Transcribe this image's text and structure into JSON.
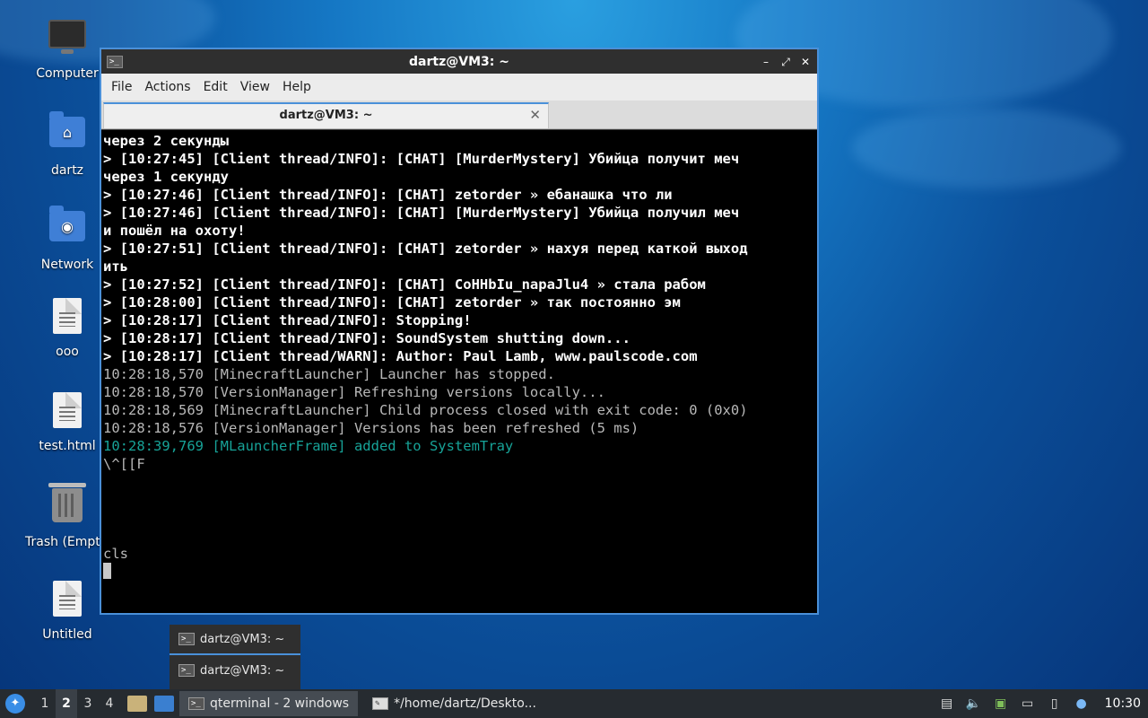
{
  "desktop": {
    "icons": [
      {
        "label": "Computer"
      },
      {
        "label": "dartz"
      },
      {
        "label": "Network"
      },
      {
        "label": "ooo"
      },
      {
        "label": "test.html"
      },
      {
        "label": "Trash (Empty)"
      },
      {
        "label": "Untitled"
      }
    ]
  },
  "window": {
    "title": "dartz@VM3: ~",
    "icon_glyph": ">_",
    "controls": {
      "minimize": "–",
      "maximize": "⤢",
      "close": "✕"
    },
    "menu": [
      "File",
      "Actions",
      "Edit",
      "View",
      "Help"
    ],
    "tab": {
      "title": "dartz@VM3: ~",
      "close": "✕"
    }
  },
  "terminal": {
    "lines": [
      {
        "text": "через 2 секунды",
        "style": "bold"
      },
      {
        "text": "> [10:27:45] [Client thread/INFO]: [CHAT] [MurderMystery] Убийца получит меч",
        "style": "bold"
      },
      {
        "text": "через 1 секунду",
        "style": "bold"
      },
      {
        "text": "> [10:27:46] [Client thread/INFO]: [CHAT] zetorder » ебанашка что ли",
        "style": "bold"
      },
      {
        "text": "> [10:27:46] [Client thread/INFO]: [CHAT] [MurderMystery] Убийца получил меч",
        "style": "bold"
      },
      {
        "text": "и пошёл на охоту!",
        "style": "bold"
      },
      {
        "text": "> [10:27:51] [Client thread/INFO]: [CHAT] zetorder » нахуя перед каткой выход",
        "style": "bold"
      },
      {
        "text": "ить",
        "style": "bold"
      },
      {
        "text": "> [10:27:52] [Client thread/INFO]: [CHAT] CoHHbIu_napaJlu4 » стала рабом",
        "style": "bold"
      },
      {
        "text": "> [10:28:00] [Client thread/INFO]: [CHAT] zetorder » так постоянно эм",
        "style": "bold"
      },
      {
        "text": "> [10:28:17] [Client thread/INFO]: Stopping!",
        "style": "bold"
      },
      {
        "text": "> [10:28:17] [Client thread/INFO]: SoundSystem shutting down...",
        "style": "bold"
      },
      {
        "text": "> [10:28:17] [Client thread/WARN]: Author: Paul Lamb, www.paulscode.com",
        "style": "bold"
      },
      {
        "text": "10:28:18,570 [MinecraftLauncher] Launcher has stopped.",
        "style": "dim"
      },
      {
        "text": "10:28:18,570 [VersionManager] Refreshing versions locally...",
        "style": "dim"
      },
      {
        "text": "10:28:18,569 [MinecraftLauncher] Child process closed with exit code: 0 (0x0)",
        "style": "dim"
      },
      {
        "text": "10:28:18,576 [VersionManager] Versions has been refreshed (5 ms)",
        "style": "dim"
      },
      {
        "text": "10:28:39,769 [MLauncherFrame] added to SystemTray",
        "style": "cyan"
      },
      {
        "text": "\\^[[F",
        "style": "dim"
      },
      {
        "text": "",
        "style": "dim"
      },
      {
        "text": "",
        "style": "dim"
      },
      {
        "text": "",
        "style": "dim"
      },
      {
        "text": "",
        "style": "dim"
      },
      {
        "text": "cls",
        "style": "dim"
      }
    ]
  },
  "task_popup": {
    "items": [
      {
        "label": "dartz@VM3: ~"
      },
      {
        "label": "dartz@VM3: ~"
      }
    ]
  },
  "taskbar": {
    "workspaces": [
      "1",
      "2",
      "3",
      "4"
    ],
    "active_workspace": "2",
    "tasks": [
      {
        "label": "qterminal - 2 windows"
      },
      {
        "label": "*/home/dartz/Deskto..."
      }
    ],
    "clock": "10:30"
  },
  "colors": {
    "accent": "#4a90d9",
    "terminal_bg": "#000000",
    "terminal_cyan": "#17a398",
    "taskbar_bg": "#262b30"
  }
}
